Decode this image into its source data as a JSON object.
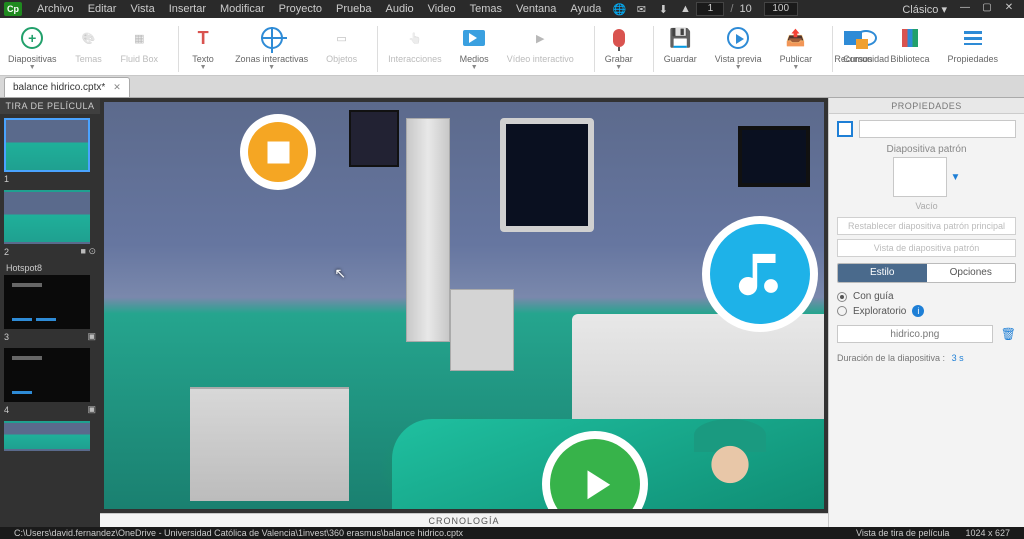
{
  "titlebar": {
    "app_badge": "Cp",
    "menu": [
      "Archivo",
      "Editar",
      "Vista",
      "Insertar",
      "Modificar",
      "Proyecto",
      "Prueba",
      "Audio",
      "Video",
      "Temas",
      "Ventana",
      "Ayuda"
    ],
    "page_current": "1",
    "page_sep": "/",
    "page_total": "10",
    "zoom": "100",
    "workspace": "Clásico ▾"
  },
  "ribbon": {
    "slides": "Diapositivas",
    "themes": "Temas",
    "fluidbox": "Fluid Box",
    "text": "Texto",
    "zones": "Zonas interactivas",
    "objects": "Objetos",
    "interactions": "Interacciones",
    "media": "Medios",
    "interactive_video": "Vídeo interactivo",
    "record": "Grabar",
    "save": "Guardar",
    "preview": "Vista previa",
    "publish": "Publicar",
    "community": "Comunidad",
    "resources": "Recursos",
    "library": "Biblioteca",
    "properties": "Propiedades"
  },
  "tabs": {
    "file_name": "balance hidrico.cptx*"
  },
  "filmstrip": {
    "header": "TIRA DE PELÍCULA",
    "slides": [
      {
        "num": "1",
        "kind": "hospital",
        "selected": true
      },
      {
        "num": "2",
        "kind": "hospital"
      },
      {
        "label": "Hotspot8"
      },
      {
        "num": "3",
        "kind": "dark"
      },
      {
        "num": "4",
        "kind": "dark"
      },
      {
        "num": "",
        "kind": "hospital"
      }
    ]
  },
  "timeline": {
    "label": "CRONOLOGÍA"
  },
  "props": {
    "title": "PROPIEDADES",
    "master_title": "Diapositiva patrón",
    "master_empty": "Vacío",
    "reset_master": "Restablecer diapositiva patrón principal",
    "view_master": "Vista de diapositiva patrón",
    "seg_style": "Estilo",
    "seg_options": "Opciones",
    "guided": "Con guía",
    "exploratory": "Exploratorio",
    "image_name": "hidrico.png",
    "duration_label": "Duración de la diapositiva :",
    "duration_value": "3 s"
  },
  "status": {
    "path": "C:\\Users\\david.fernandez\\OneDrive - Universidad Católica de Valencia\\1invest\\360 erasmus\\balance hidrico.cptx",
    "view": "Vista de tira de película",
    "dims": "1024 x 627"
  }
}
